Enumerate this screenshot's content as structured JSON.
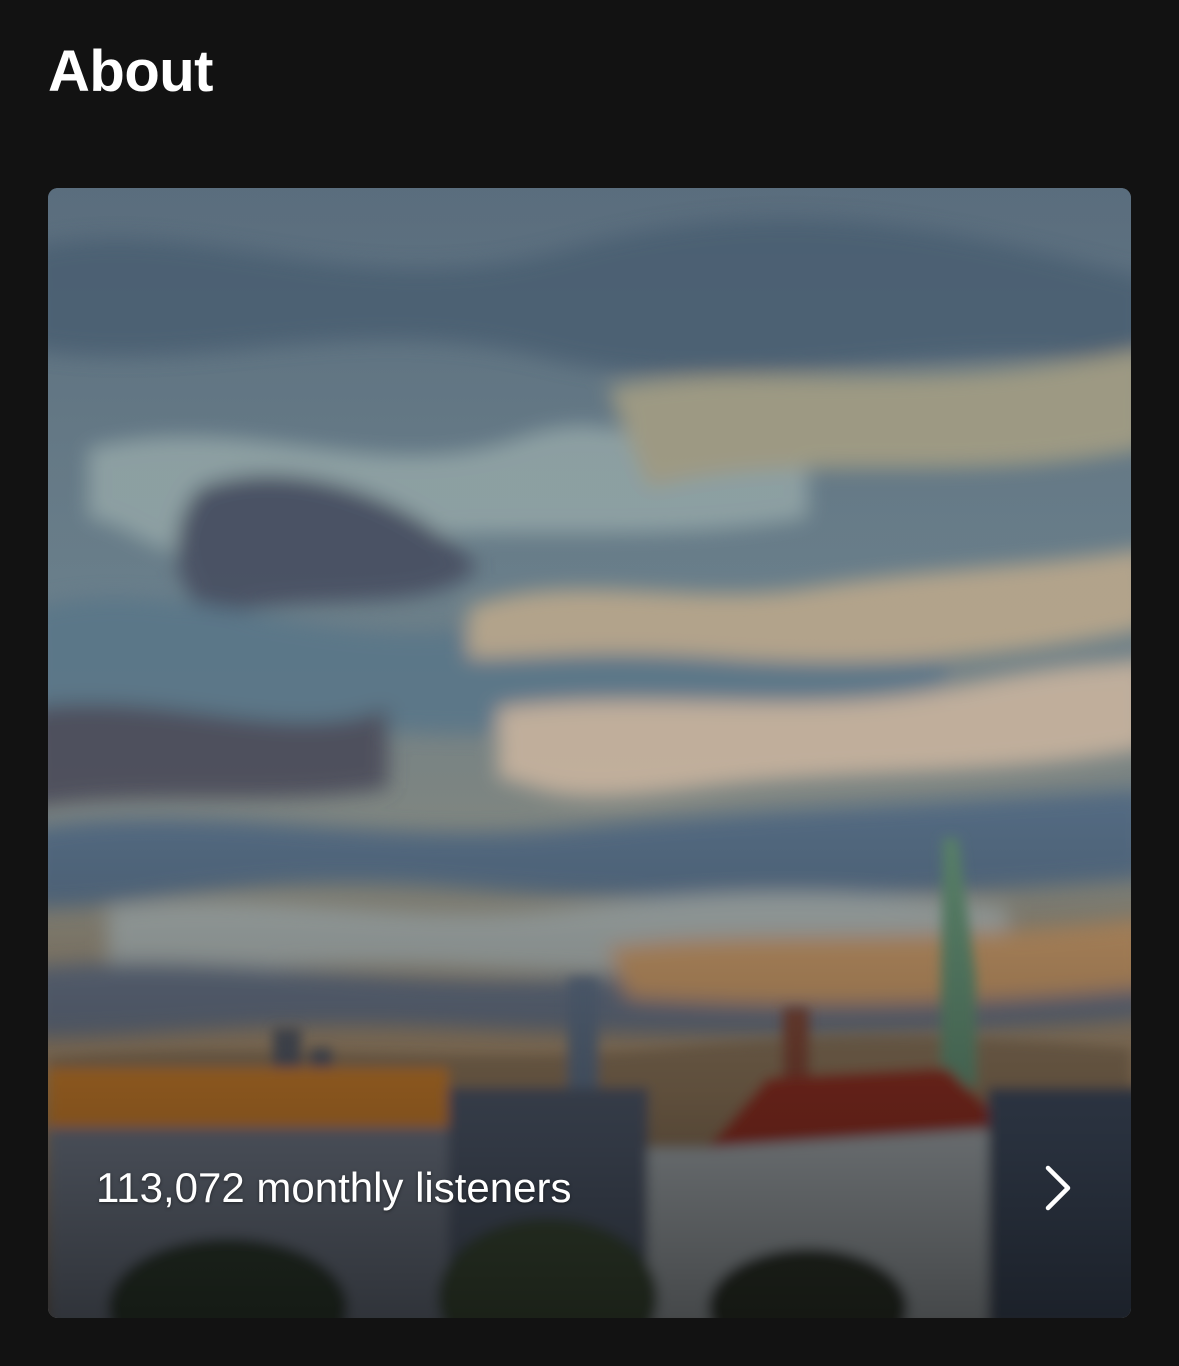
{
  "section": {
    "title": "About"
  },
  "card": {
    "listeners_text": "113,072 monthly listeners",
    "image_icon": "artist-painting-image",
    "chevron_icon": "chevron-right-icon"
  },
  "colors": {
    "background": "#121212",
    "text": "#ffffff"
  }
}
